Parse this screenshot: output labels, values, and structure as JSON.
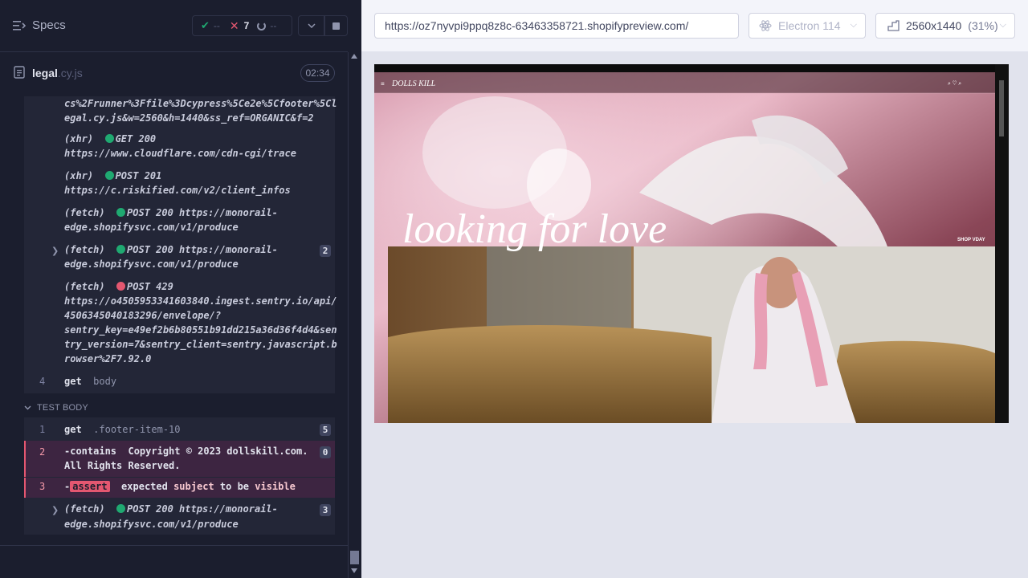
{
  "header": {
    "specs_label": "Specs",
    "passed": "--",
    "failed": "7",
    "pending": "--"
  },
  "file": {
    "name": "legal",
    "ext": ".cy.js",
    "duration": "02:34"
  },
  "log": {
    "url_tail_1": "cs%2Frunner%3Ffile%3Dcypress%5Ce2e%5Cfooter%5Cl",
    "url_tail_2": "egal.cy.js&w=2560&h=1440&ss_ref=ORGANIC&f=2",
    "xhr1_type": "(xhr)",
    "xhr1_status": "GET 200",
    "xhr1_url": "https://www.cloudflare.com/cdn-cgi/trace",
    "xhr2_type": "(xhr)",
    "xhr2_status": "POST 201",
    "xhr2_url": "https://c.riskified.com/v2/client_infos",
    "fetch1_type": "(fetch)",
    "fetch1_line1": "POST 200 https://monorail-",
    "fetch1_line2": "edge.shopifysvc.com/v1/produce",
    "fetch2_type": "(fetch)",
    "fetch2_line1": "POST 200 https://monorail-",
    "fetch2_line2": "edge.shopifysvc.com/v1/produce",
    "fetch2_count": "2",
    "fetch3_type": "(fetch)",
    "fetch3_status": "POST 429",
    "fetch3_l1": "https://o4505953341603840.ingest.sentry.io/api/",
    "fetch3_l2": "4506345040183296/envelope/?",
    "fetch3_l3": "sentry_key=e49ef2b6b80551b91dd215a36d36f4d4&sen",
    "fetch3_l4": "try_version=7&sentry_client=sentry.javascript.b",
    "fetch3_l5": "rowser%2F7.92.0",
    "cmd4_num": "4",
    "cmd4_name": "get",
    "cmd4_arg": "body"
  },
  "test_body": {
    "header": "TEST BODY",
    "c1_num": "1",
    "c1_name": "get",
    "c1_arg": ".footer-item-10",
    "c1_count": "5",
    "c2_num": "2",
    "c2_name": "-contains",
    "c2_arg1": "Copyright © 2023 dollskill.com.",
    "c2_arg2": "All Rights Reserved.",
    "c2_count": "0",
    "c3_num": "3",
    "c3_dash": "-",
    "c3_tag": "assert",
    "c3_w1": "expected",
    "c3_w2": "subject",
    "c3_w3": "to be",
    "c3_w4": "visible",
    "f_type": "(fetch)",
    "f_line1": "POST 200 https://monorail-",
    "f_line2": "edge.shopifysvc.com/v1/produce",
    "f_count": "3"
  },
  "topbar": {
    "url": "https://oz7nyvpi9ppq8z8c-63463358721.shopifypreview.com/",
    "browser": "Electron 114",
    "viewport": "2560x1440",
    "zoom": "(31%)"
  },
  "aut": {
    "logo": "DOLLS KILL",
    "headline": "looking for love",
    "cta": "SHOP VDAY"
  },
  "colors": {
    "pass": "#1fa971",
    "fail": "#e45770",
    "panel_bg": "#1b1e2e"
  }
}
